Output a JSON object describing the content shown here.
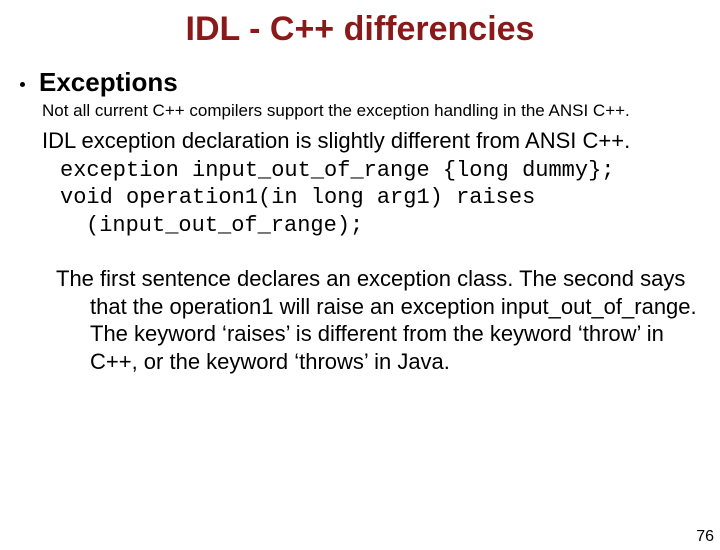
{
  "title": "IDL - C++ differencies",
  "bullet": "Exceptions",
  "subnote": "Not all current C++ compilers support the exception handling in the ANSI C++.",
  "subline": "IDL exception declaration is slightly different from ANSI C++.",
  "code1": "exception input_out_of_range {long dummy};",
  "code2": "void operation1(in long arg1) raises (input_out_of_range);",
  "paragraph": "The first sentence declares an exception class. The second says that the operation1 will raise an exception input_out_of_range. The keyword ‘raises’ is different from the keyword ‘throw’ in C++, or the keyword ‘throws’ in Java.",
  "page": "76"
}
